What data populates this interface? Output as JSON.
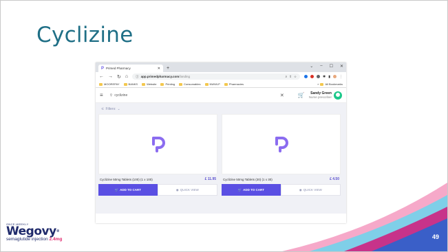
{
  "slide": {
    "title": "Cyclizine",
    "page_number": "49"
  },
  "logo": {
    "small_text": "ONCE-WEEKLY",
    "brand": "Wegovy",
    "brand_mark": "®",
    "subtitle": "semaglutide injection",
    "dose": "2.4mg"
  },
  "browser": {
    "tab_label": "Primed Pharmacy",
    "url_host": "app.primedpharmacy.com",
    "url_path": "/landing",
    "bookmarks": [
      "MOOREPAY",
      "BANKS",
      "Website",
      "Printing",
      "Consumables",
      "NWWLP",
      "Pharmacies"
    ],
    "all_bookmarks_label": "All Bookmarks"
  },
  "app": {
    "search_value": "cyclizine",
    "user_name": "Sandy Green",
    "user_role": "Nurse prescriber",
    "filters_label": "Filters:",
    "products": [
      {
        "name": "Cyclizine 50mg Tablets (100) (1 x 100)",
        "price": "£ 11.95",
        "add_label": "ADD TO CART",
        "view_label": "QUICK VIEW"
      },
      {
        "name": "Cyclizine 50mg Tablets (30) (1 x 30)",
        "price": "£ 4.50",
        "add_label": "ADD TO CART",
        "view_label": "QUICK VIEW"
      }
    ]
  },
  "colors": {
    "title": "#1f6f86",
    "accent": "#5a4fe3",
    "brand_logo": "#8b6cf0"
  }
}
